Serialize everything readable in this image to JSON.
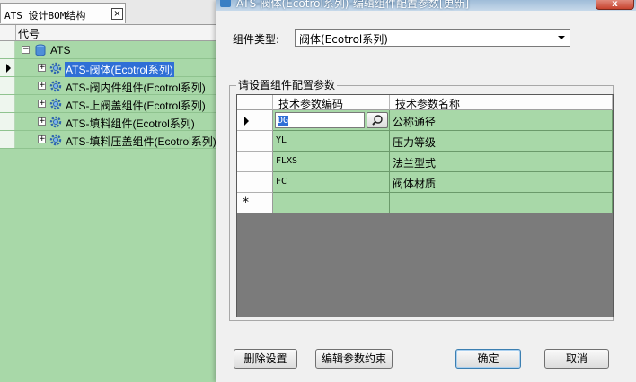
{
  "left_panel": {
    "tab_title": "ATS 设计BOM结构",
    "tab_close": "×",
    "column_header": "代号",
    "root_label": "ATS",
    "collapse_glyph": "−",
    "expand_glyph": "+",
    "items": [
      {
        "label": "ATS-阀体(Ecotrol系列)"
      },
      {
        "label": "ATS-阀内件组件(Ecotrol系列)"
      },
      {
        "label": "ATS-上阀盖组件(Ecotrol系列)"
      },
      {
        "label": "ATS-填料组件(Ecotrol系列)"
      },
      {
        "label": "ATS-填料压盖组件(Ecotrol系列)"
      }
    ]
  },
  "dialog": {
    "title": "ATS-阀体(Ecotrol系列)-编辑组件配置参数[更新]",
    "close_label": "x",
    "component_type_label": "组件类型:",
    "component_type_value": "阀体(Ecotrol系列)",
    "group_title": "请设置组件配置参数",
    "grid": {
      "headers": [
        "技术参数编码",
        "技术参数名称"
      ],
      "rows": [
        {
          "code": "DG",
          "name": "公称通径"
        },
        {
          "code": "YL",
          "name": "压力等级"
        },
        {
          "code": "FLXS",
          "name": "法兰型式"
        },
        {
          "code": "FC",
          "name": "阀体材质"
        }
      ],
      "new_row_marker": "*"
    },
    "buttons": {
      "delete": "删除设置",
      "edit_constraints": "编辑参数约束",
      "ok": "确定",
      "cancel": "取消"
    }
  },
  "colors": {
    "row_green": "#a8d8a8",
    "grid_empty": "#7b7b7b",
    "selection_blue": "#2f6fd6"
  }
}
